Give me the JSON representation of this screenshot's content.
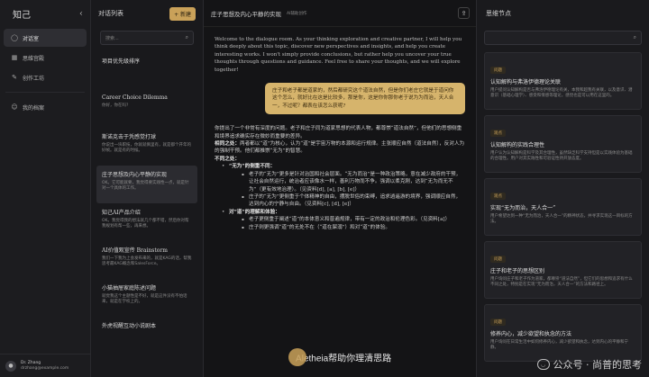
{
  "nav": {
    "title": "知己",
    "items": [
      {
        "label": "对话室",
        "icon": "chat-icon"
      },
      {
        "label": "思维宫殿",
        "icon": "map-icon"
      },
      {
        "label": "创作工坊",
        "icon": "pen-icon"
      }
    ],
    "profile_label": "我的档案",
    "user_name": "Dr. Zhang",
    "user_email": "drzhang@example.com"
  },
  "list": {
    "title": "对话列表",
    "new_button": "+ 新建",
    "search_placeholder": "搜索...",
    "items": [
      {
        "title": "项目优先级排序",
        "preview": ""
      },
      {
        "title": "Career Choice Dilemma",
        "preview": "你好，你在吗?"
      },
      {
        "title": "斯诺克击于凭感觉打球",
        "preview": "你说出一块职技，你就就俩里有，就是都个开年的好帧。就是有的时候。"
      },
      {
        "title": "庄子思想及内心平静的实现",
        "preview": "OK。它可能就要，我觉得要实践性一点，就是针对一个具体的工作。"
      },
      {
        "title": "知己AI产品介绍",
        "preview": "OK。我觉得我的想法就几个都不错，然后你对帮我规划有帮一些，再来想。"
      },
      {
        "title": "AI价值观宣传 Brainstorm",
        "preview": "我们一下我为上会发布来的，就是KAG的话，帮我思考最KAG概念和SalesForce。"
      },
      {
        "title": "小猫抽屉家庭陈述问题",
        "preview": "就觉我这个主题性是不好，就是这件没有不怕话来，就是在学校上的。"
      },
      {
        "title": "外虎视醒互动小说剧本",
        "preview": ""
      }
    ]
  },
  "main": {
    "title": "庄子思想及内心平静的实现",
    "subtitle": "AI辅助创作",
    "welcome": "Welcome to the dialogue room. As your thinking exploration and creative partner, I will help you think deeply about this topic, discover new perspectives and insights, and help you create interesting works. I won't simply provide conclusions, but rather help you uncover your true thoughts through questions and guidance. Feel free to share your thoughts, and we will explore together!",
    "user_message": "庄子和老子都是道家的，然后都研究这个道法自然，但是你们老庄它就是于道问你这个怎么，就好比在这是比较多，那是你，这是你你那你老于说为为而治，天人合一，不过呢？都表在该怎么获呢?",
    "answer_intro": "你提出了一个非常有深度的问题。老子和庄子同为道家思想的代表人物，都尊崇“道法自然”，但他们的思想侧重和境界追求确实存在微妙而重要的差异。",
    "answer_similar_label": "相同之处：",
    "answer_similar": "两者都以“道”为核心，认为“道”是宇宙万物的本源和运行规律。主张顺应自然（道法自然），反对人为的强制干预。他们都推崇“无为”的智慧。",
    "answer_diff_label": "不同之处：",
    "wuwei_label": "“无为”的侧重不同：",
    "laozi_wuwei": "老子的“无为”更多是针对治国和社会层面。“无为而治”是一种政治策略，意在减少政府的干预，让社会自然运行，统治者应该像水一样，善利万物而不争。强调以柔克刚，达到“无为而无不为”（更有效地治理）。（见资料[d], [a], [b], [e]）",
    "zhuangzi_wuwei": "庄子的“无为”更侧重于个体精神的自由，摆脱世俗的束缚，追求逍遥游的境界，强调顺应自然，达到内心的宁静与自由。（见资料[c], [d], [e]）",
    "dao_label": "对“道”的理解和体验：",
    "laozi_dao": "老子更侧重于阐述“道”的本体意义和普遍规律，带有一定的政治和伦理色彩。（见资料[a]）",
    "zhuangzi_dao": "庄子则更强调“道”的无处不在（“道在屎溺”）和对“道”的体验。",
    "cta_text": "Aletheia帮助你理清思路"
  },
  "right": {
    "title": "思维节点",
    "cards": [
      {
        "tag": "问题",
        "title": "认知解构与弗洛伊德理论关联",
        "preview": "用户提问认知解构是否与弗洛伊德理论有关，本我和超我有关联，以及意识、潜意识（基础心理学）、感受和情感等理论，感觉也是可以用在这里的。"
      },
      {
        "tag": "观点",
        "title": "认知解构的实践合理性",
        "preview": "用户认为认知解构是科学及其合理性，虽然缺乏科学支持但是以实践体验为基础的合理性。用户对其实践性和可验证性持开放态度。"
      },
      {
        "tag": "观点",
        "title": "实现“无为而治，天人合一”",
        "preview": "用户希望达到一种“无为而治，天人合一”的精神状态，并寻求实现这一目标的方法。"
      },
      {
        "tag": "问题",
        "title": "庄子和老子的思想区别",
        "preview": "用户询问庄子和老子作为道家，都尊崇“道法自然”，但它们的思想和追求有什么不同之处，特别是在实现“无为而治，天人合一”的方法和路径上。"
      },
      {
        "tag": "问题",
        "title": "修养内心，减少欲望和执念的方法",
        "preview": "用户询问在日常生活中如何修养内心，减少欲望和执念，达到内心的平静和宁静。"
      }
    ]
  },
  "watermark": "公众号 · 尚普的思考"
}
